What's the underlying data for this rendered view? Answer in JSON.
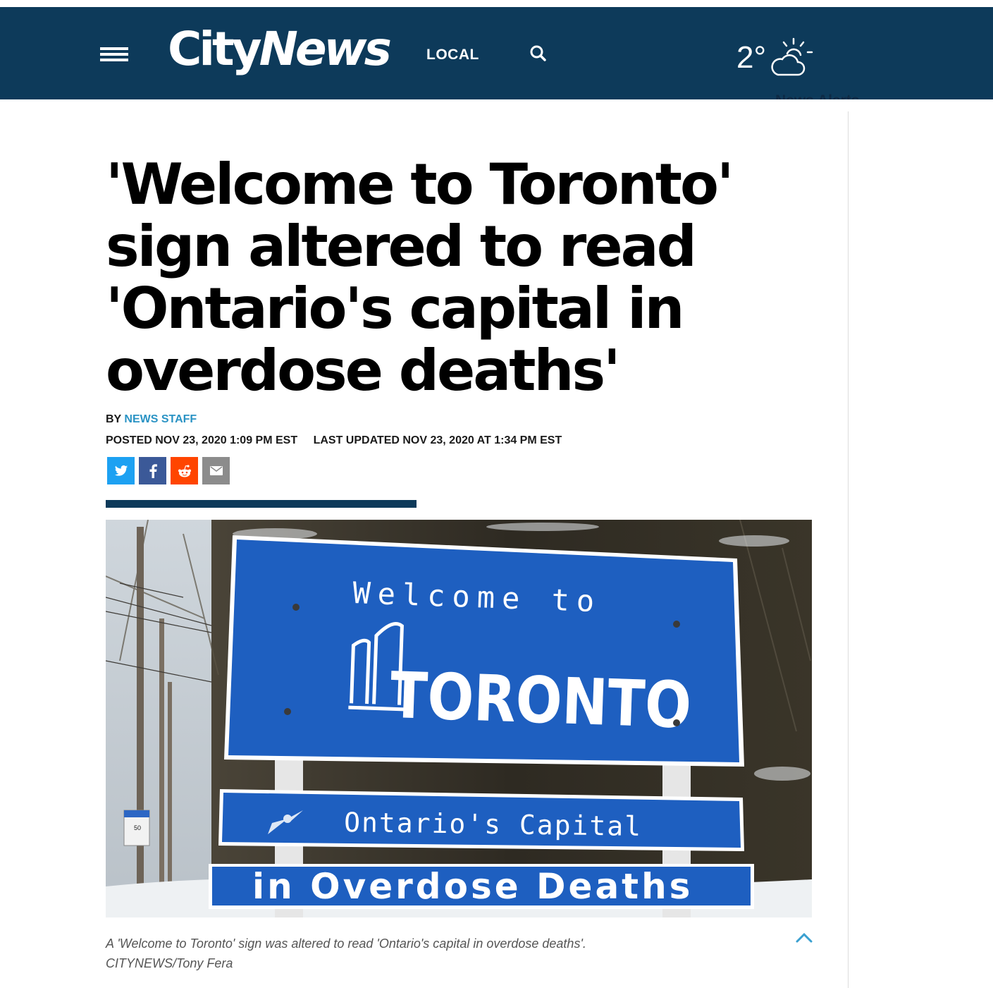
{
  "header": {
    "brand": {
      "city": "City",
      "news": "News"
    },
    "nav_local": "LOCAL",
    "weather": {
      "temperature": "2°",
      "icon": "partly-cloudy-icon"
    },
    "news_alerts": "News Alerts"
  },
  "article": {
    "headline": "'Welcome to Toronto' sign altered to read 'Ontario's capital in overdose deaths'",
    "byline_prefix": "BY",
    "author": "NEWS STAFF",
    "posted": "POSTED NOV 23, 2020 1:09 PM EST",
    "updated": "LAST UPDATED NOV 23, 2020 AT 1:34 PM EST",
    "share_icons": [
      "twitter-icon",
      "facebook-icon",
      "reddit-icon",
      "email-icon"
    ],
    "photo_text": {
      "welcome": "Welcome to",
      "city": "TORONTO",
      "line2": "Ontario's Capital",
      "line3": "in Overdose Deaths",
      "speed": "50"
    },
    "caption": "A 'Welcome to Toronto' sign was altered to read 'Ontario's capital in overdose deaths'.",
    "credit": "CITYNEWS/Tony Fera"
  },
  "colors": {
    "header_bg": "#0d3a5a",
    "author_link": "#2a93c4",
    "sign_blue": "#1e5fc0"
  }
}
